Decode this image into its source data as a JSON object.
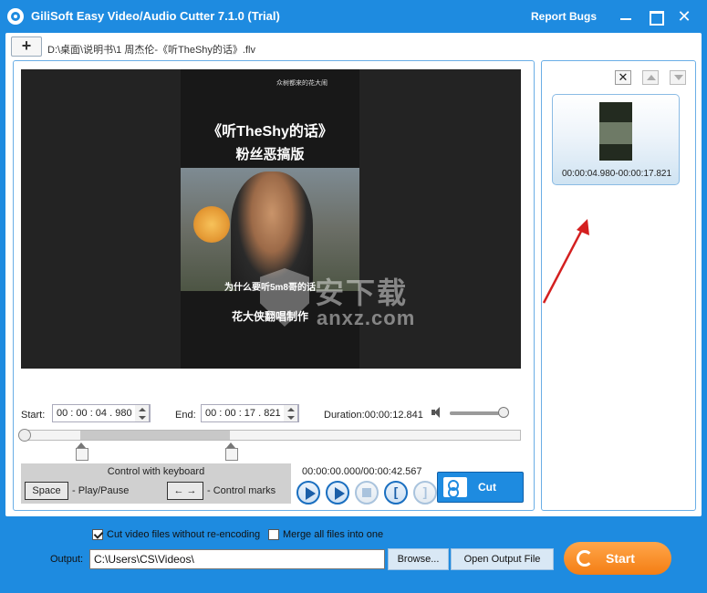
{
  "window": {
    "title": "GiliSoft Easy Video/Audio Cutter 7.1.0 (Trial)",
    "report_bugs": "Report Bugs",
    "close_glyph": "✕"
  },
  "toolbar": {
    "add_label": "+",
    "file_path": "D:\\桌面\\说明书\\1 周杰伦-《听TheShy的话》.flv"
  },
  "video": {
    "overlay_small": "众树都来的花大闹",
    "title_line1": "《听TheShy的话》",
    "title_line2": "粉丝恶搞版",
    "subtitle1": "为什么要听5m8哥的话",
    "subtitle2": "花大侠翻唱制作",
    "watermark_line1": "安下载",
    "watermark_line2": "anxz.com"
  },
  "timing": {
    "start_label": "Start:",
    "start_value": "00 : 00 : 04 . 980",
    "end_label": "End:",
    "end_value": "00 : 00 : 17 . 821",
    "duration_label": "Duration:00:00:12.841",
    "volume": 0.9
  },
  "keyboard": {
    "title": "Control with keyboard",
    "space_key": "Space",
    "space_desc": "- Play/Pause",
    "arrow_keys": "← →",
    "arrow_desc": "- Control marks"
  },
  "playback": {
    "time_readout": "00:00:00.000/00:00:42.567",
    "mark_in_glyph": "[",
    "mark_out_glyph": "]"
  },
  "cut": {
    "label": "Cut"
  },
  "clips": {
    "remove_glyph": "✕",
    "items": [
      {
        "time": "00:00:04.980-00:00:17.821"
      }
    ]
  },
  "options": {
    "no_reencode_label": "Cut video files without re-encoding",
    "merge_label": "Merge all files into one",
    "output_label": "Output:",
    "output_value": "C:\\Users\\CS\\Videos\\",
    "browse_label": "Browse...",
    "open_output_label": "Open Output File",
    "start_label": "Start"
  },
  "colors": {
    "accent": "#1e8be0",
    "start_orange": "#f48a1e",
    "annotation_arrow": "#d42020"
  }
}
